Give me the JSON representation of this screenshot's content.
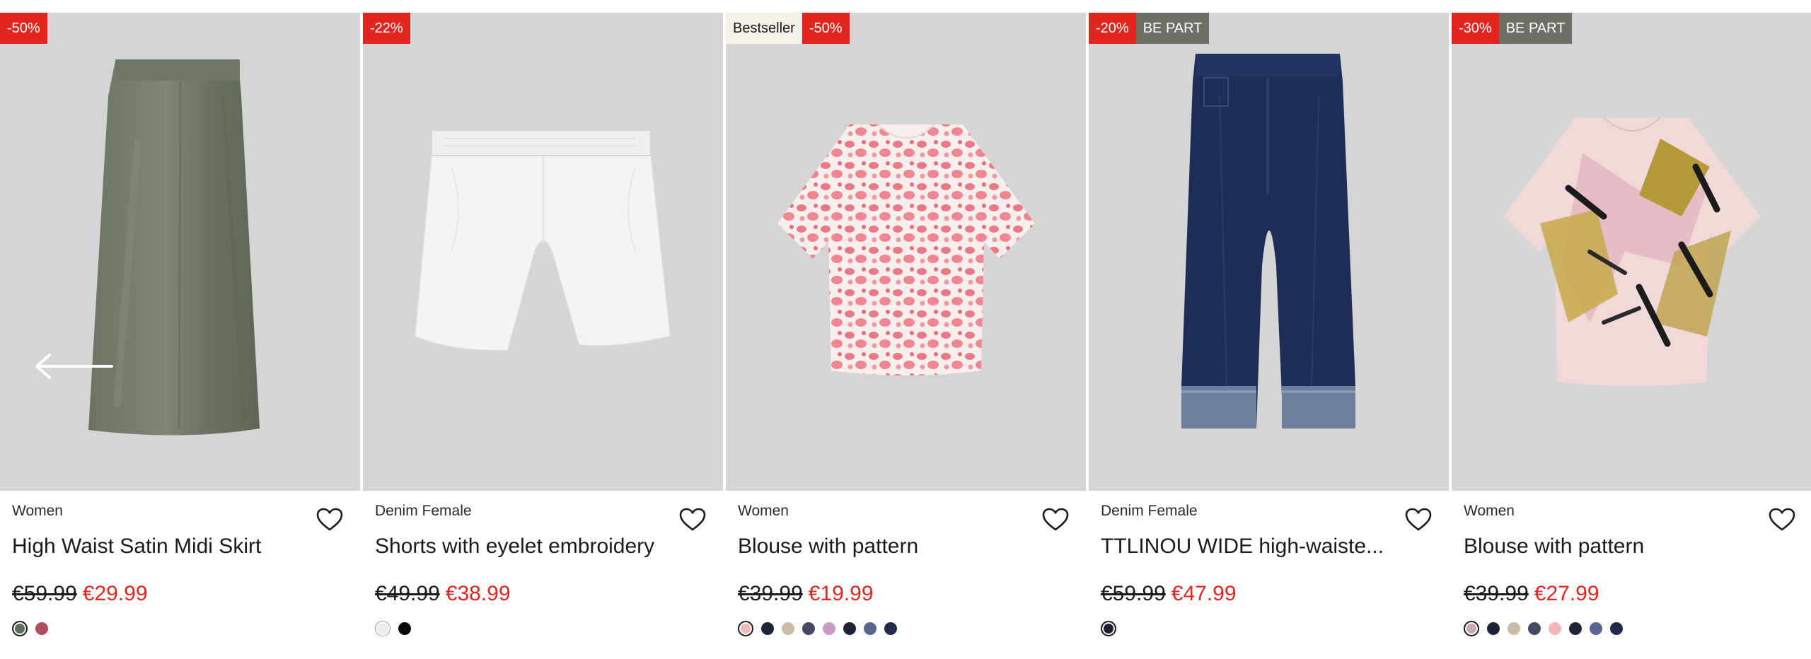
{
  "products": [
    {
      "badges": [
        {
          "text": "-50%",
          "style": "red"
        }
      ],
      "category": "Women",
      "name": "High Waist Satin Midi Skirt",
      "old_price": "€59.99",
      "new_price": "€29.99",
      "swatches": [
        "#5f6b5b",
        "#b14b5d"
      ],
      "icon": "satin-skirt"
    },
    {
      "badges": [
        {
          "text": "-22%",
          "style": "red"
        }
      ],
      "category": "Denim Female",
      "name": "Shorts with eyelet embroidery",
      "old_price": "€49.99",
      "new_price": "€38.99",
      "swatches": [
        "#ececec",
        "#0a0a0a"
      ],
      "icon": "white-shorts"
    },
    {
      "badges": [
        {
          "text": "Bestseller",
          "style": "light"
        },
        {
          "text": "-50%",
          "style": "red"
        }
      ],
      "category": "Women",
      "name": "Blouse with pattern",
      "old_price": "€39.99",
      "new_price": "€19.99",
      "swatches": [
        "#f3b7bb",
        "#1e2338",
        "#c9bca7",
        "#454a63",
        "#c79dc4",
        "#1e2338",
        "#5a6491",
        "#1f2a4b"
      ],
      "icon": "pink-blouse"
    },
    {
      "badges": [
        {
          "text": "-20%",
          "style": "red"
        },
        {
          "text": "BE PART",
          "style": "dark"
        }
      ],
      "category": "Denim Female",
      "name": "TTLINOU WIDE high-waiste...",
      "old_price": "€59.99",
      "new_price": "€47.99",
      "swatches": [
        "#1c2233"
      ],
      "icon": "denim-jeans"
    },
    {
      "badges": [
        {
          "text": "-30%",
          "style": "red"
        },
        {
          "text": "BE PART",
          "style": "dark"
        }
      ],
      "category": "Women",
      "name": "Blouse with pattern",
      "old_price": "€39.99",
      "new_price": "€27.99",
      "swatches": [
        "#c7a9b5",
        "#1e2338",
        "#c9bca7",
        "#454a63",
        "#f3b7bb",
        "#1e2338",
        "#5a6491",
        "#1f2a4b"
      ],
      "icon": "abstract-blouse"
    }
  ],
  "colors": {
    "sale_red": "#e0261e",
    "badge_dark": "#6e6f67",
    "badge_light": "#f5f2ea",
    "image_bg": "#d5d5d5"
  }
}
